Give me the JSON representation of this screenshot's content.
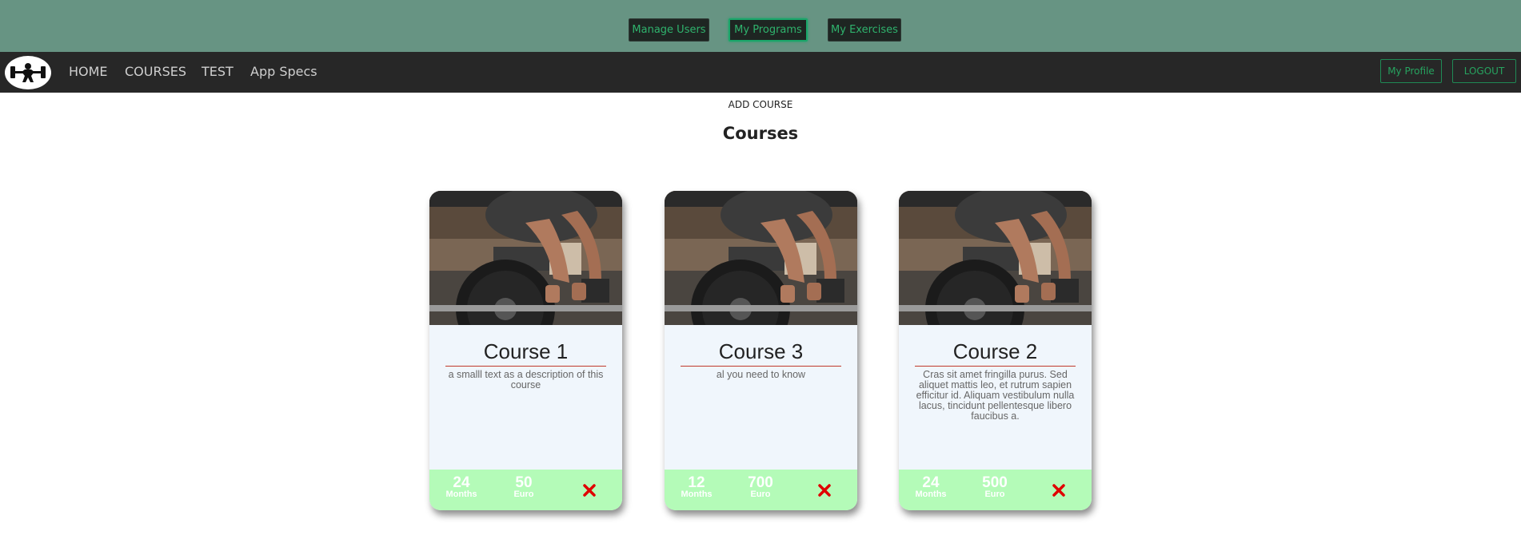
{
  "admin_bar": {
    "buttons": [
      {
        "label": "Manage Users"
      },
      {
        "label": "My Programs"
      },
      {
        "label": "My Exercises"
      }
    ]
  },
  "navbar": {
    "logo": "weightlifter-logo-icon",
    "links": [
      {
        "label": "HOME"
      },
      {
        "label": "COURSES"
      },
      {
        "label": "TEST"
      },
      {
        "label": "App Specs"
      }
    ],
    "profile_label": "My Profile",
    "logout_label": "LOGOUT"
  },
  "main": {
    "add_course_label": "ADD COURSE",
    "title": "Courses"
  },
  "courses": [
    {
      "title": "Course 1",
      "description": "a smalll text as a description of this course",
      "duration": "24",
      "duration_unit": "Months",
      "price": "50",
      "price_unit": "Euro"
    },
    {
      "title": "Course 3",
      "description": "al you need to know",
      "duration": "12",
      "duration_unit": "Months",
      "price": "700",
      "price_unit": "Euro"
    },
    {
      "title": "Course 2",
      "description": "Cras sit amet fringilla purus. Sed aliquet mattis leo, et rutrum sapien efficitur id. Aliquam vestibulum nulla lacus, tincidunt pellentesque libero faucibus a.",
      "duration": "24",
      "duration_unit": "Months",
      "price": "500",
      "price_unit": "Euro"
    }
  ],
  "colors": {
    "admin_bar": "#679483",
    "navbar": "#272727",
    "accent_green": "#27a35f",
    "card_footer": "#b4fbb8",
    "delete_red": "#e00000"
  }
}
